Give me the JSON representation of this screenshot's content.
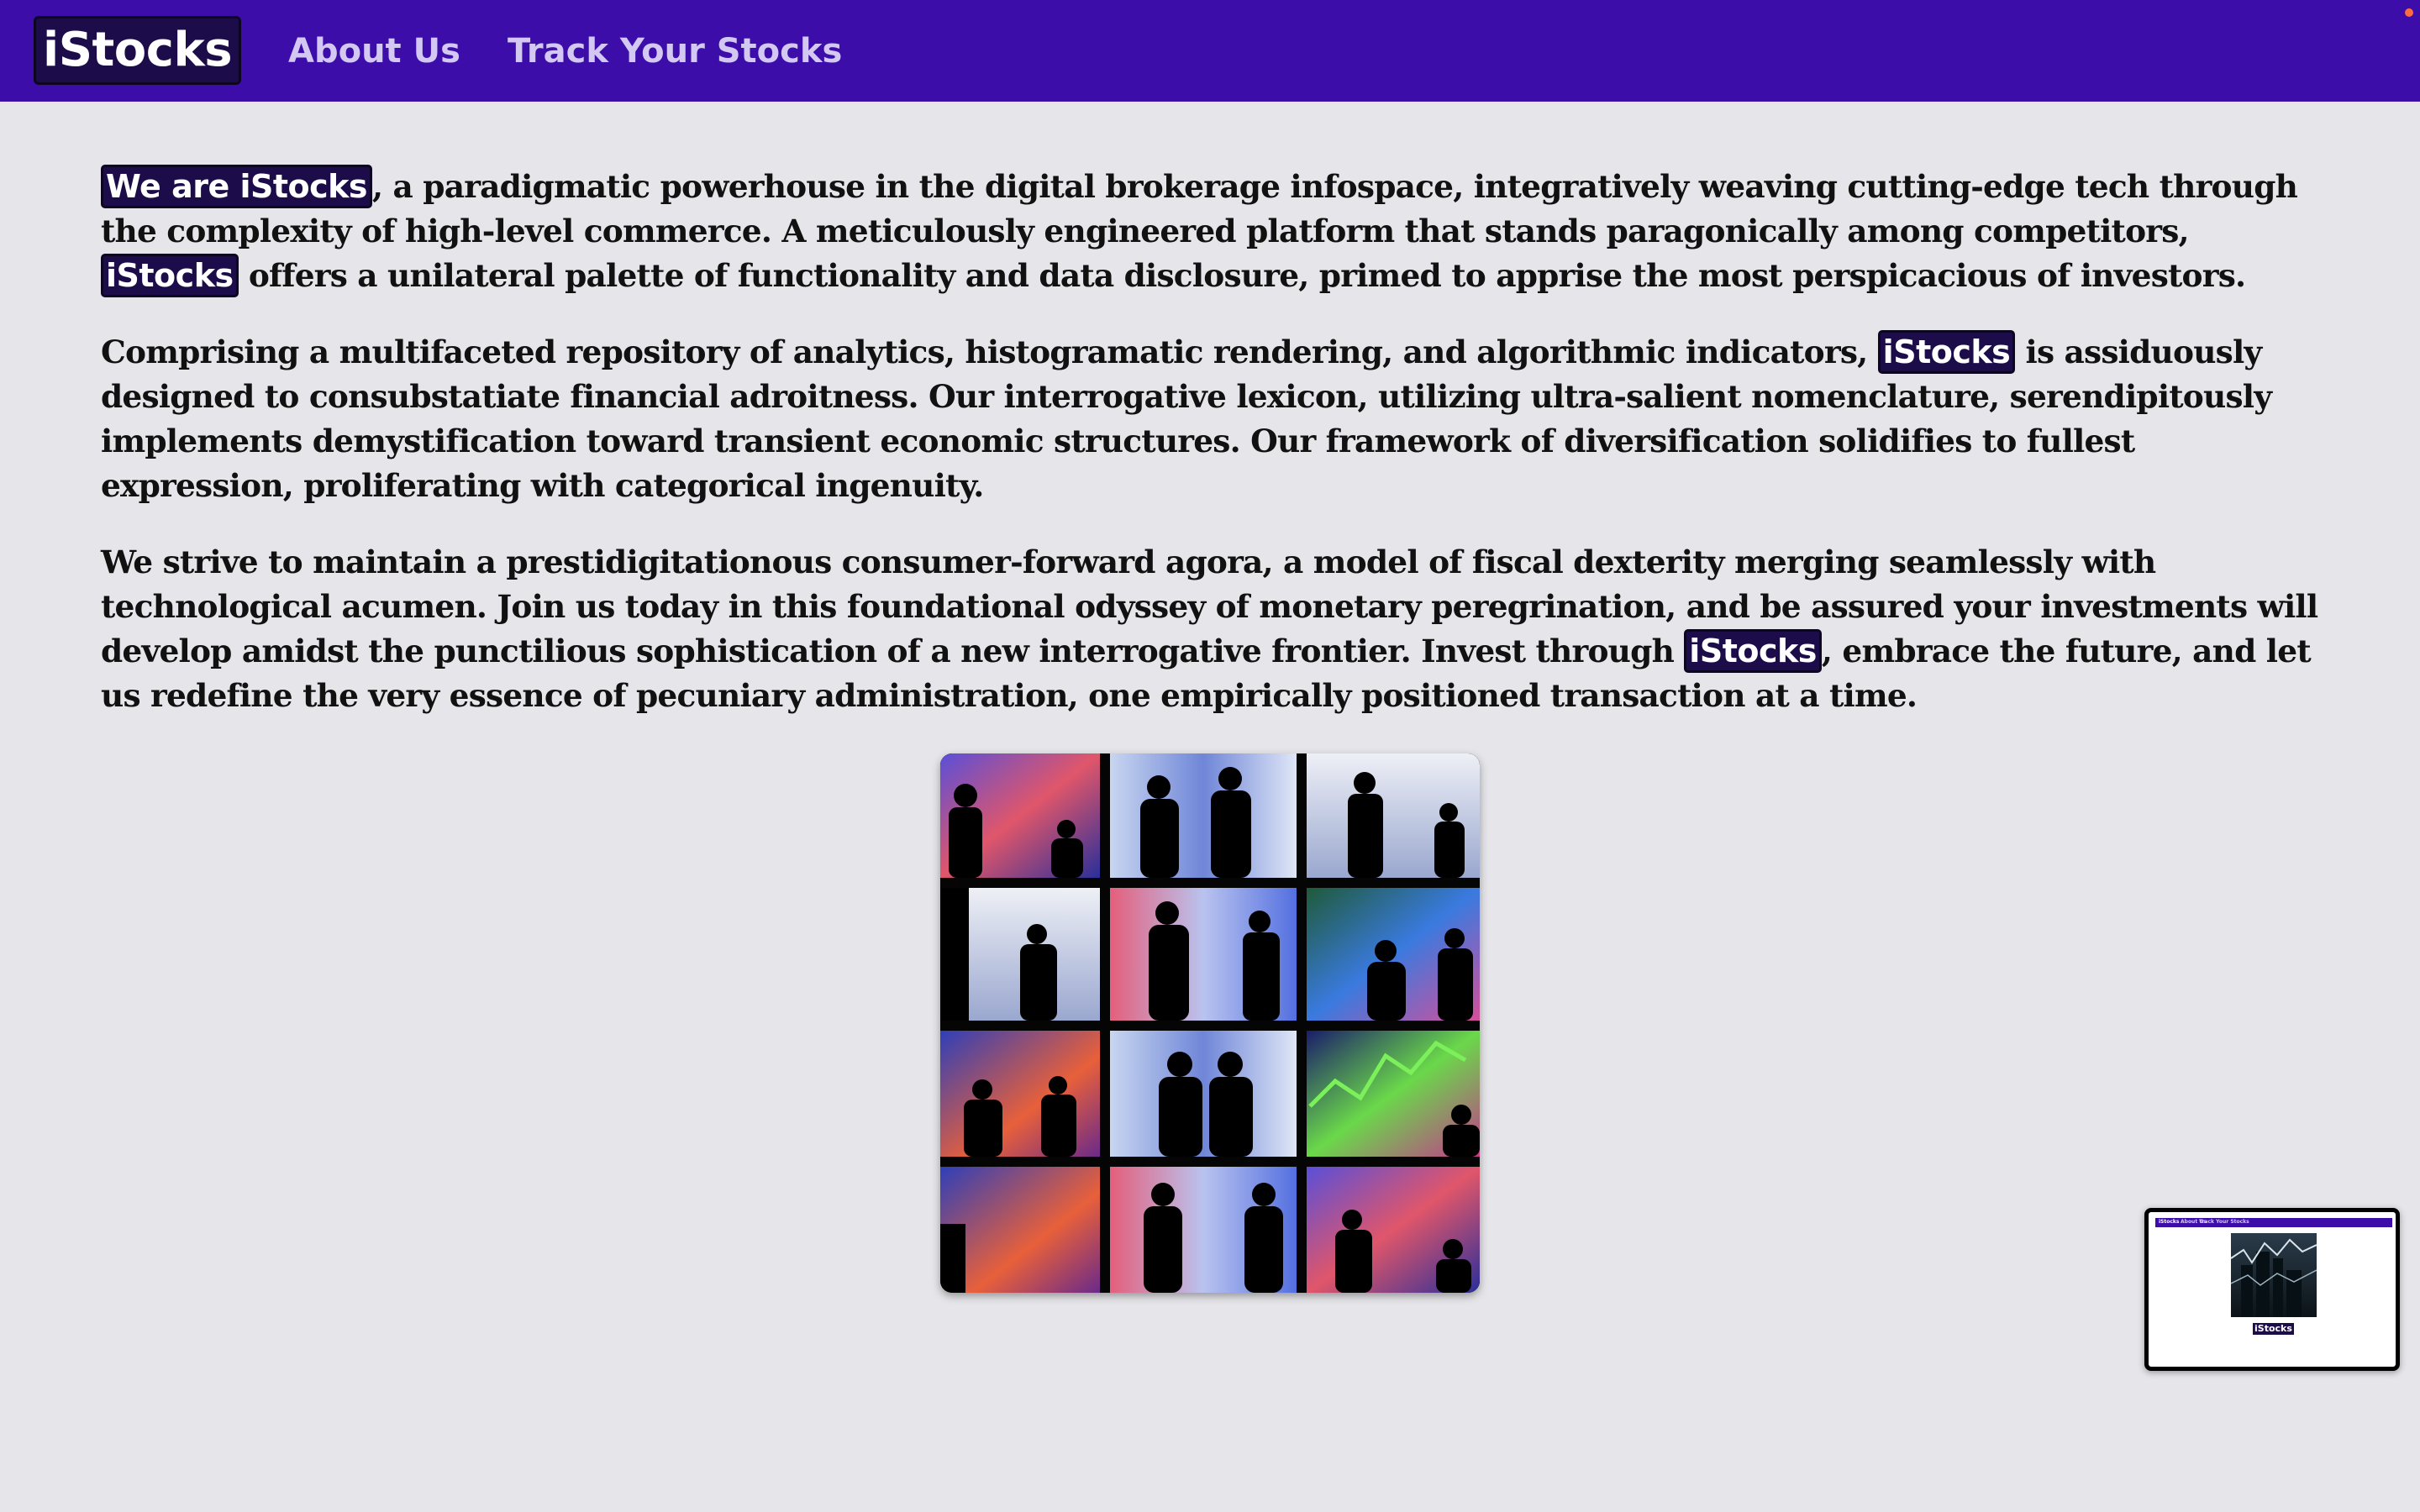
{
  "nav": {
    "brand": "iStocks",
    "links": [
      "About Us",
      "Track Your Stocks"
    ]
  },
  "about": {
    "p1": {
      "lead": "We are iStocks",
      "t1": ", a paradigmatic powerhouse in the digital brokerage infospace, integratively weaving cutting-edge tech through the complexity of high-level commerce. A meticulously engineered platform that stands paragonically among competitors, ",
      "tag": "iStocks",
      "t2": " offers a unilateral palette of functionality and data disclosure, primed to apprise the most perspicacious of investors."
    },
    "p2": {
      "t1": "Comprising a multifaceted repository of analytics, histogramatic rendering, and algorithmic indicators, ",
      "tag": "iStocks",
      "t2": " is assiduously designed to consubstatiate financial adroitness. Our interrogative lexicon, utilizing ultra-salient nomenclature, serendipitously implements demystification toward transient economic structures. Our framework of diversification solidifies to fullest expression, proliferating with categorical ingenuity."
    },
    "p3": {
      "t1": "We strive to maintain a prestidigitationous consumer-forward agora, a model of fiscal dexterity merging seamlessly with technological acumen. Join us today in this foundational odyssey of monetary peregrination, and be assured your investments will develop amidst the punctilious sophistication of a new interrogative frontier. Invest through ",
      "tag": "iStocks",
      "t2": ", embrace the future, and let us redefine the very essence of pecuniary administration, one empirically positioned transaction at a time."
    }
  },
  "preview": {
    "brand": "iStocks",
    "links": [
      "About Us",
      "Track Your Stocks"
    ],
    "tag": "iStocks"
  },
  "colors": {
    "navbar": "#3d0daa",
    "tag_bg": "#1c0d4a",
    "page_bg": "#e6e6ea",
    "nav_link": "#d3c8f2"
  }
}
